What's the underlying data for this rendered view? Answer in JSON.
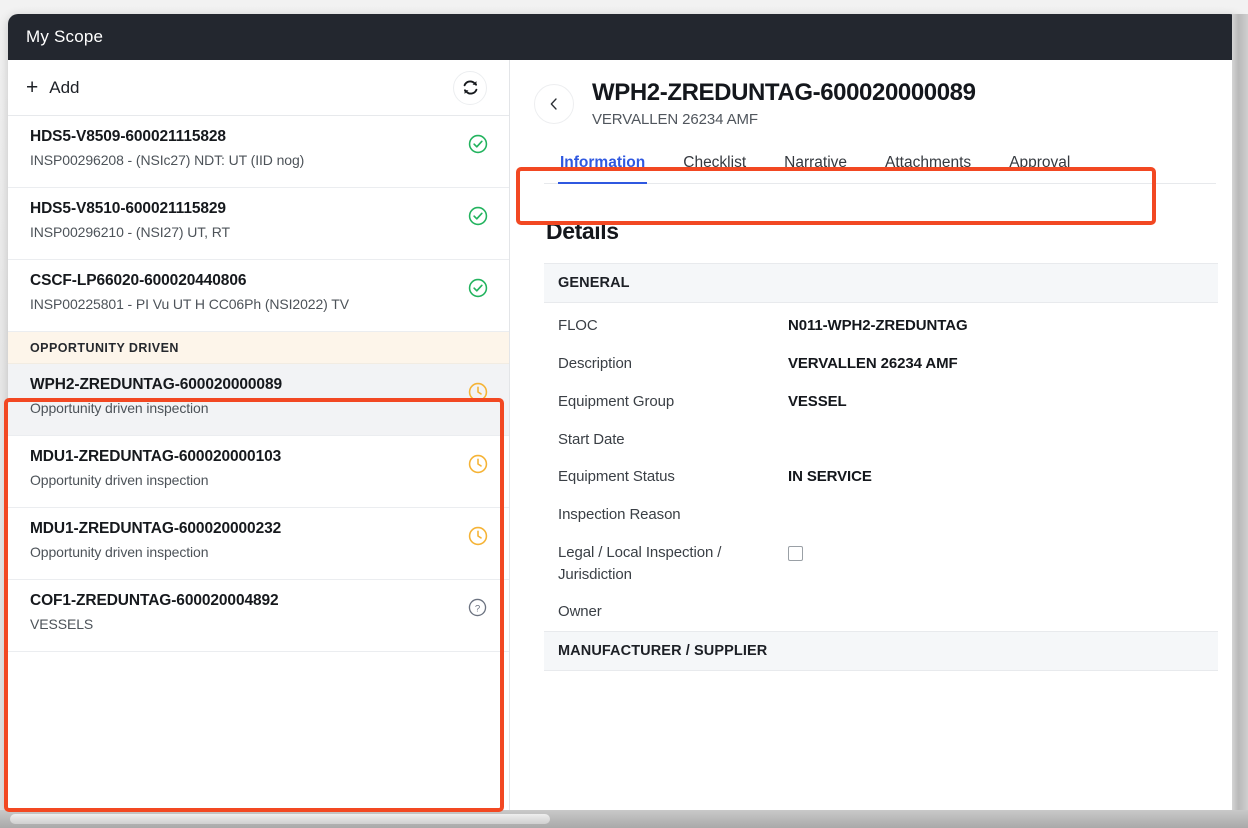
{
  "window": {
    "title": "My Scope"
  },
  "sidebar": {
    "add_label": "Add",
    "plus_glyph": "+",
    "refresh_icon": "refresh-icon",
    "items": [
      {
        "title": "HDS5-V8509-600021115828",
        "subtitle": "INSP00296208 - (NSIc27) NDT: UT (IID nog)",
        "status": "check",
        "selected": false
      },
      {
        "title": "HDS5-V8510-600021115829",
        "subtitle": "INSP00296210 - (NSI27) UT, RT",
        "status": "check",
        "selected": false
      },
      {
        "title": "CSCF-LP66020-600020440806",
        "subtitle": "INSP00225801 - PI Vu UT H CC06Ph (NSI2022) TV",
        "status": "check",
        "selected": false
      }
    ],
    "group": {
      "label": "OPPORTUNITY DRIVEN",
      "items": [
        {
          "title": "WPH2-ZREDUNTAG-600020000089",
          "subtitle": "Opportunity driven inspection",
          "status": "clock",
          "selected": true
        },
        {
          "title": "MDU1-ZREDUNTAG-600020000103",
          "subtitle": "Opportunity driven inspection",
          "status": "clock",
          "selected": false
        },
        {
          "title": "MDU1-ZREDUNTAG-600020000232",
          "subtitle": "Opportunity driven inspection",
          "status": "clock",
          "selected": false
        },
        {
          "title": "COF1-ZREDUNTAG-600020004892",
          "subtitle": "VESSELS",
          "status": "question",
          "selected": false
        }
      ]
    }
  },
  "detail": {
    "back_icon": "chevron-left-icon",
    "title": "WPH2-ZREDUNTAG-600020000089",
    "subtitle": "VERVALLEN 26234 AMF",
    "tabs": [
      {
        "label": "Information",
        "active": true
      },
      {
        "label": "Checklist",
        "active": false
      },
      {
        "label": "Narrative",
        "active": false
      },
      {
        "label": "Attachments",
        "active": false
      },
      {
        "label": "Approval",
        "active": false
      }
    ],
    "details_heading": "Details",
    "sections": [
      {
        "header": "GENERAL",
        "fields": [
          {
            "label": "FLOC",
            "value": "N011-WPH2-ZREDUNTAG",
            "type": "text"
          },
          {
            "label": "Description",
            "value": "VERVALLEN 26234 AMF",
            "type": "text"
          },
          {
            "label": "Equipment Group",
            "value": "VESSEL",
            "type": "text"
          },
          {
            "label": "Start Date",
            "value": "",
            "type": "text"
          },
          {
            "label": "Equipment Status",
            "value": "IN SERVICE",
            "type": "text"
          },
          {
            "label": "Inspection Reason",
            "value": "",
            "type": "text"
          },
          {
            "label": "Legal / Local Inspection / Jurisdiction",
            "value": "",
            "type": "checkbox",
            "checked": false
          },
          {
            "label": "Owner",
            "value": "",
            "type": "text"
          }
        ]
      },
      {
        "header": "MANUFACTURER / SUPPLIER",
        "fields": []
      }
    ]
  },
  "colors": {
    "accent_blue": "#2f58e0",
    "annotation_red": "#f24822",
    "status_green": "#22b35e",
    "status_amber": "#f5b335",
    "status_gray": "#6b7280",
    "titlebar": "#23272f",
    "group_header_bg": "#fdf5ea"
  }
}
